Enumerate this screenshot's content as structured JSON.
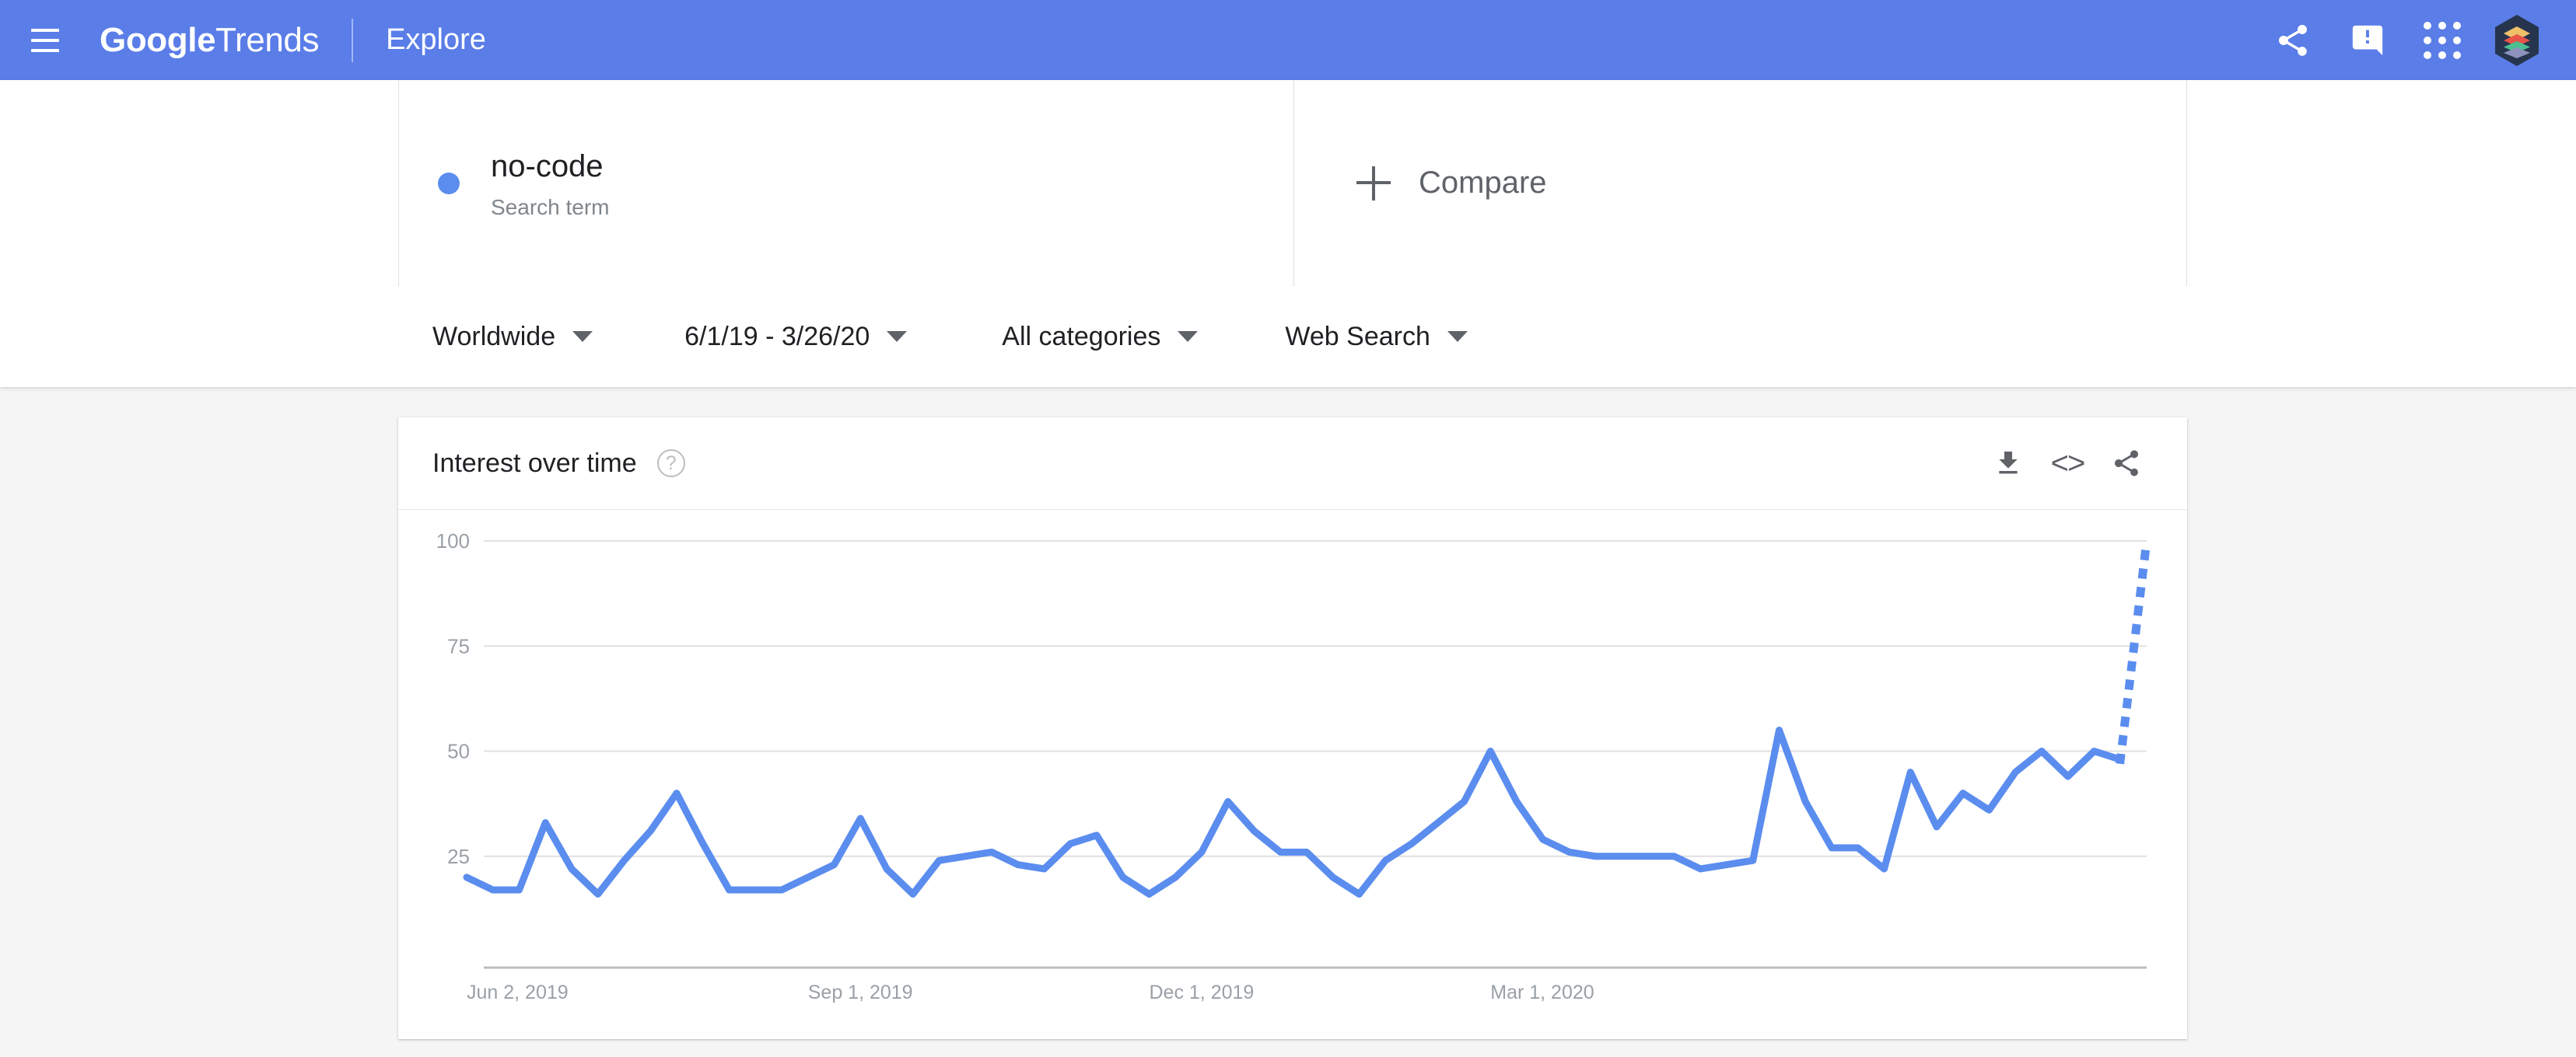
{
  "appbar": {
    "menu_icon": "hamburger-menu-icon",
    "brand_bold": "Google",
    "brand_light": "Trends",
    "nav_label": "Explore",
    "share_icon": "share-icon",
    "feedback_icon": "feedback-icon",
    "apps_icon": "apps-grid-icon",
    "avatar_icon": "account-avatar-icon",
    "background_color": "#5a7de8"
  },
  "search_terms": {
    "items": [
      {
        "label": "no-code",
        "type": "Search term",
        "color": "#5b8def"
      }
    ],
    "compare_label": "Compare",
    "compare_icon": "plus-icon"
  },
  "filters": [
    {
      "name": "location",
      "value": "Worldwide"
    },
    {
      "name": "time-range",
      "value": "6/1/19 - 3/26/20"
    },
    {
      "name": "category",
      "value": "All categories"
    },
    {
      "name": "search-type",
      "value": "Web Search"
    }
  ],
  "chart_card": {
    "title": "Interest over time",
    "help_icon": "help-circle-icon",
    "help_glyph": "?",
    "actions": [
      {
        "name": "download-button",
        "icon": "download-icon"
      },
      {
        "name": "embed-button",
        "icon": "embed-code-icon",
        "glyph": "<>"
      },
      {
        "name": "share-button",
        "icon": "share-icon"
      }
    ]
  },
  "chart_data": {
    "type": "line",
    "title": "Interest over time",
    "xlabel": "",
    "ylabel": "",
    "ylim": [
      0,
      100
    ],
    "yticks": [
      25,
      50,
      75,
      100
    ],
    "ytick_labels": [
      "25",
      "50",
      "75",
      "100"
    ],
    "grid": true,
    "legend": false,
    "line_color": "#5b8def",
    "xtick_labels": [
      "Jun 2, 2019",
      "Sep 1, 2019",
      "Dec 1, 2019",
      "Mar 1, 2020"
    ],
    "xtick_positions": [
      0,
      13,
      26,
      39
    ],
    "x_start": "Jun 2, 2019",
    "x_end": "Mar 26, 2020",
    "partial_last_segment": true,
    "series": [
      {
        "name": "no-code",
        "values": [
          20,
          17,
          17,
          33,
          22,
          16,
          24,
          31,
          40,
          28,
          17,
          17,
          17,
          20,
          23,
          34,
          22,
          16,
          24,
          25,
          26,
          23,
          22,
          28,
          30,
          20,
          16,
          20,
          26,
          38,
          31,
          26,
          26,
          20,
          16,
          24,
          28,
          33,
          38,
          50,
          38,
          29,
          26,
          25,
          25,
          25,
          25,
          22,
          23,
          24,
          55,
          38,
          27,
          27,
          22,
          45,
          32,
          40,
          36,
          45,
          50,
          44,
          50,
          48,
          100
        ]
      }
    ]
  }
}
